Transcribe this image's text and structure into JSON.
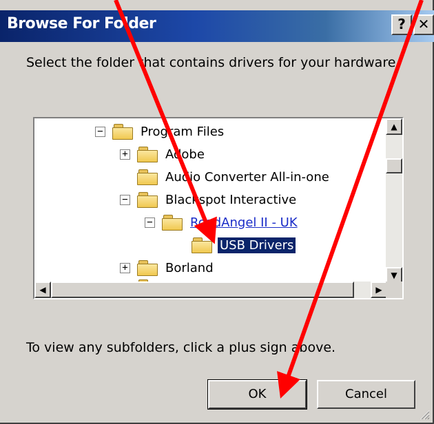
{
  "window": {
    "title": "Browse For Folder",
    "help_glyph": "?",
    "close_glyph": "✕"
  },
  "instruction": "Select the folder that contains drivers for your hardware.",
  "tree": {
    "items": [
      {
        "label": "Program Files",
        "expander": "−",
        "state": "expanded"
      },
      {
        "label": "Adobe",
        "expander": "+",
        "state": "collapsed"
      },
      {
        "label": "Audio Converter All-in-one",
        "expander": "",
        "state": "leaf"
      },
      {
        "label": "Blackspot Interactive",
        "expander": "−",
        "state": "expanded"
      },
      {
        "label": "RoadAngel II - UK",
        "expander": "−",
        "state": "expanded-link"
      },
      {
        "label": "USB Drivers",
        "expander": "",
        "state": "selected"
      },
      {
        "label": "Borland",
        "expander": "+",
        "state": "collapsed"
      }
    ],
    "scroll_up_glyph": "▲",
    "scroll_down_glyph": "▼",
    "scroll_left_glyph": "◀",
    "scroll_right_glyph": "▶"
  },
  "hint": "To view any subfolders, click a plus sign above.",
  "buttons": {
    "ok": "OK",
    "cancel": "Cancel"
  },
  "colors": {
    "title_bar": "#0a246a",
    "selection": "#0a246a",
    "annotation_arrow": "#ff0000",
    "link": "#1a2cc8"
  },
  "annotation": {
    "arrows": 2,
    "color": "red"
  }
}
